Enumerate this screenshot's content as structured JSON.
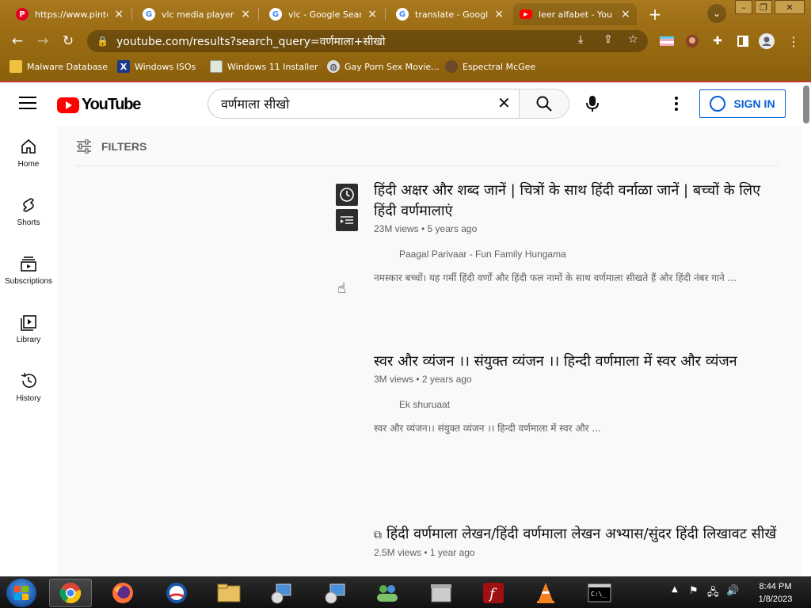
{
  "browser": {
    "tabs": [
      {
        "title": "https://www.pinte",
        "favicon": "pinterest-icon",
        "color": "#e60023",
        "active": false
      },
      {
        "title": "vlc media player d",
        "favicon": "google-icon",
        "color": "#ffffff",
        "active": false
      },
      {
        "title": "vlc - Google Searc",
        "favicon": "google-icon",
        "color": "#ffffff",
        "active": false
      },
      {
        "title": "translate - Google",
        "favicon": "google-icon",
        "color": "#ffffff",
        "active": false
      },
      {
        "title": "leer alfabet - You",
        "favicon": "youtube-icon",
        "color": "#ff0000",
        "active": true
      }
    ],
    "new_tab": "+",
    "url": "youtube.com/results?search_query=वर्णमाला+सीखो",
    "bookmarks": [
      {
        "label": "Malware Database",
        "icon": "folder-icon"
      },
      {
        "label": "Windows ISOs",
        "icon": "x-icon"
      },
      {
        "label": "Windows 11 Installer",
        "icon": "image-icon"
      },
      {
        "label": "Gay Porn Sex Movie...",
        "icon": "globe-icon"
      },
      {
        "label": "Espectral McGee",
        "icon": "avatar-icon"
      }
    ]
  },
  "youtube": {
    "logo_text": "YouTube",
    "search_value": "वर्णमाला सीखो",
    "sign_in": "SIGN IN",
    "guide": [
      {
        "label": "Home",
        "icon": "home-icon"
      },
      {
        "label": "Shorts",
        "icon": "shorts-icon"
      },
      {
        "label": "Subscriptions",
        "icon": "subscriptions-icon"
      },
      {
        "label": "Library",
        "icon": "library-icon"
      },
      {
        "label": "History",
        "icon": "history-icon"
      }
    ],
    "filters_label": "FILTERS",
    "videos": [
      {
        "title": "हिंदी अक्षर और शब्द जानें | चित्रों के साथ हिंदी वर्नाळा जानें | बच्चों के लिए हिंदी वर्णमालाएं",
        "meta": "23M views • 5 years ago",
        "channel": "Paagal Parivaar - Fun Family Hungama",
        "description": "नमस्कार बच्चों। यह गर्मी हिंदी वर्णों और हिंदी फल नामों के साथ वर्णमाला सीखते हैं और हिंदी नंबर गाने ..."
      },
      {
        "title": "स्वर और व्यंजन ।। संयुक्त व्यंजन ।। हिन्दी वर्णमाला में स्वर और व्यंजन",
        "meta": "3M views • 2 years ago",
        "channel": "Ek shuruaat",
        "description": "स्वर और व्यंजन।। संयुक्त व्यंजन ।। हिन्दी वर्णमाला में स्वर और ..."
      },
      {
        "title": "हिंदी वर्णमाला लेखन/हिंदी वर्णमाला लेखन अभ्यास/सुंदर हिंदी लिखावट सीखें",
        "meta": "2.5M views • 1 year ago",
        "channel": "",
        "description": ""
      }
    ]
  },
  "taskbar": {
    "time": "8:44 PM",
    "date": "1/8/2023"
  }
}
